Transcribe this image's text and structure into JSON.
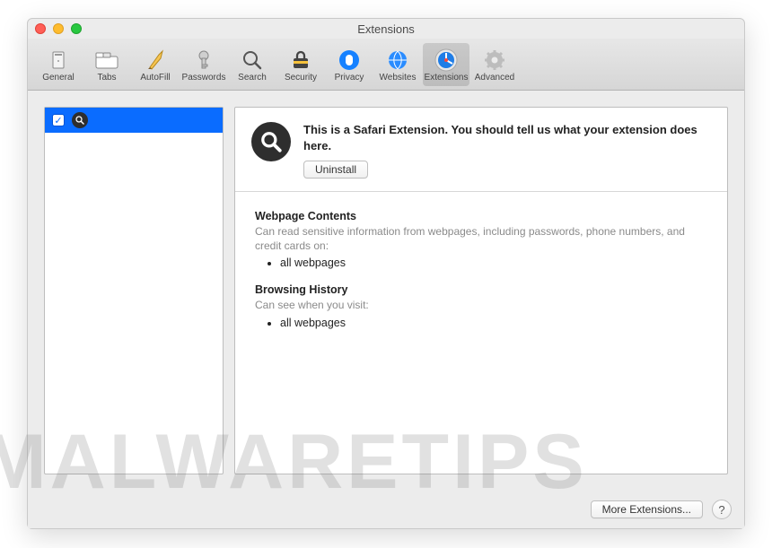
{
  "window": {
    "title": "Extensions"
  },
  "toolbar": {
    "items": [
      {
        "label": "General"
      },
      {
        "label": "Tabs"
      },
      {
        "label": "AutoFill"
      },
      {
        "label": "Passwords"
      },
      {
        "label": "Search"
      },
      {
        "label": "Security"
      },
      {
        "label": "Privacy"
      },
      {
        "label": "Websites"
      },
      {
        "label": "Extensions"
      },
      {
        "label": "Advanced"
      }
    ],
    "active_index": 8
  },
  "sidebar": {
    "items": [
      {
        "checked": true,
        "name": ""
      }
    ]
  },
  "detail": {
    "description": "This is a Safari Extension. You should tell us what your extension does here.",
    "uninstall_label": "Uninstall",
    "sections": [
      {
        "title": "Webpage Contents",
        "desc": "Can read sensitive information from webpages, including passwords, phone numbers, and credit cards on:",
        "bullets": [
          "all webpages"
        ]
      },
      {
        "title": "Browsing History",
        "desc": "Can see when you visit:",
        "bullets": [
          "all webpages"
        ]
      }
    ]
  },
  "footer": {
    "more_label": "More Extensions...",
    "help_label": "?"
  },
  "watermark": "MALWARETIPS"
}
